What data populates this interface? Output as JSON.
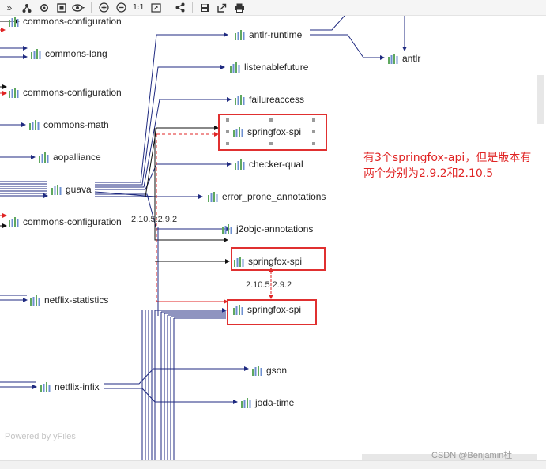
{
  "toolbar": {
    "buttons": [
      {
        "name": "collapse-panel-icon",
        "glyph": "»"
      },
      {
        "name": "hierarchy-layout-icon",
        "glyph": ""
      },
      {
        "name": "refresh-layout-icon",
        "glyph": ""
      },
      {
        "name": "fit-content-icon",
        "glyph": ""
      },
      {
        "name": "eye-view-icon",
        "glyph": ""
      },
      {
        "name": "zoom-in-icon",
        "glyph": ""
      },
      {
        "name": "zoom-out-icon",
        "glyph": ""
      },
      {
        "name": "actual-size-icon",
        "glyph": "1:1"
      },
      {
        "name": "fit-page-icon",
        "glyph": ""
      },
      {
        "name": "share-graph-icon",
        "glyph": ""
      },
      {
        "name": "save-icon",
        "glyph": ""
      },
      {
        "name": "export-icon",
        "glyph": ""
      },
      {
        "name": "print-icon",
        "glyph": ""
      }
    ]
  },
  "nodes": {
    "commons_configuration_top": "commons-configuration",
    "commons_lang": "commons-lang",
    "commons_configuration_mid": "commons-configuration",
    "commons_math": "commons-math",
    "aopalliance": "aopalliance",
    "guava": "guava",
    "commons_configuration_low": "commons-configuration",
    "netflix_statistics": "netflix-statistics",
    "netflix_infix": "netflix-infix",
    "antlr_runtime": "antlr-runtime",
    "antlr": "antlr",
    "listenablefuture": "listenablefuture",
    "failureaccess": "failureaccess",
    "springfox_spi_1": "springfox-spi",
    "checker_qual": "checker-qual",
    "error_prone_annotations": "error_prone_annotations",
    "j2objc_annotations": "j2objc-annotations",
    "springfox_spi_2": "springfox-spi",
    "springfox_spi_3": "springfox-spi",
    "gson": "gson",
    "joda_time": "joda-time"
  },
  "edge_labels": {
    "guava_version_conflict": "2.10.5:2.9.2",
    "spi_version_conflict": "2.10.5:2.9.2"
  },
  "annotation": "有3个springfox-api，但是版本有两个分别为2.9.2和2.10.5",
  "footer": {
    "powered_by": "Powered by yFiles",
    "watermark": "CSDN @Benjamin杜"
  },
  "colors": {
    "edge": "#1f2a80",
    "edge_black": "#111111",
    "conflict_edge": "#e02424",
    "highlight": "#e03030",
    "annotation": "#e02424",
    "icon_green": "#5fa85f",
    "icon_blue": "#6d8fd0"
  }
}
